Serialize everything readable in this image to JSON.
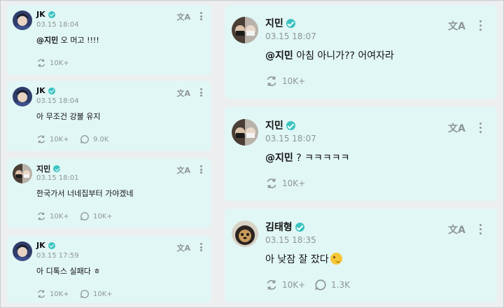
{
  "icons": {
    "translate": "文A",
    "more": "more-vertical-icon",
    "reshare": "reshare-icon",
    "comment": "comment-icon",
    "verified": "verified-badge-icon"
  },
  "colors": {
    "card_bg": "#e1f7f5",
    "badge": "#3ac3c1",
    "muted": "#8d9696"
  },
  "left_posts": [
    {
      "author": "JK",
      "time": "03.15 18:04",
      "mention": "@지민",
      "text": " 오 머고 !!!!",
      "reshares": "10K+",
      "comments": ""
    },
    {
      "author": "JK",
      "time": "03.15 18:04",
      "mention": "",
      "text": "아 무조건 강불 유지",
      "reshares": "10K+",
      "comments": "9.0K"
    },
    {
      "author": "지민",
      "time": "03.15 18:01",
      "mention": "",
      "text": "한국가서 너네집부터 가야겠네",
      "reshares": "10K+",
      "comments": "10K+"
    },
    {
      "author": "JK",
      "time": "03.15 17:59",
      "mention": "",
      "text": "아 디톡스 실패다 ㅎ",
      "reshares": "10K+",
      "comments": "10K+"
    }
  ],
  "right_posts": [
    {
      "author": "지민",
      "time": "03.15 18:07",
      "mention": "@지민",
      "text": " 아침 아니가?? 어여자라",
      "reshares": "10K+",
      "comments": ""
    },
    {
      "author": "지민",
      "time": "03.15 18:07",
      "mention": "@지민",
      "text": " ? ㅋㅋㅋㅋㅋ",
      "reshares": "10K+",
      "comments": ""
    },
    {
      "author": "김태형",
      "time": "03.15 18:35",
      "mention": "",
      "text": "아 낮잠 잘 잤다",
      "emoji": "winking-face-emoji",
      "reshares": "10K+",
      "comments": "1.3K"
    }
  ]
}
